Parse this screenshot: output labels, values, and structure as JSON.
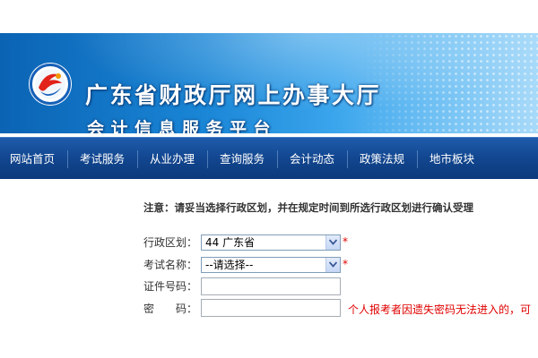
{
  "header": {
    "title": "广东省财政厅网上办事大厅",
    "subtitle": "会计信息服务平台",
    "colors": {
      "banner_dark": "#0b63b4",
      "banner_light": "#a9daf9"
    }
  },
  "logo": {
    "icon": "province-emblem-logo",
    "colors": {
      "red": "#e2231a",
      "blue": "#1560b8",
      "orange": "#f39800"
    }
  },
  "nav": {
    "items": [
      {
        "label": "网站首页"
      },
      {
        "label": "考试服务"
      },
      {
        "label": "从业办理"
      },
      {
        "label": "查询服务"
      },
      {
        "label": "会计动态"
      },
      {
        "label": "政策法规"
      },
      {
        "label": "地市板块"
      }
    ],
    "color": "#12468f"
  },
  "form": {
    "notice": "注意：请妥当选择行政区划，并在规定时间到所选行政区划进行确认受理",
    "region": {
      "label": "行政区划：",
      "value": "44 广东省",
      "required_mark": "*"
    },
    "exam": {
      "label": "考试名称：",
      "value": "--请选择--",
      "required_mark": "*"
    },
    "id_number": {
      "label": "证件号码：",
      "value": ""
    },
    "password": {
      "label": "密　　码：",
      "value": ""
    },
    "warning": "个人报考者因遗失密码无法进入的，可",
    "colors": {
      "required": "#e00000",
      "border": "#7f9db9"
    }
  }
}
